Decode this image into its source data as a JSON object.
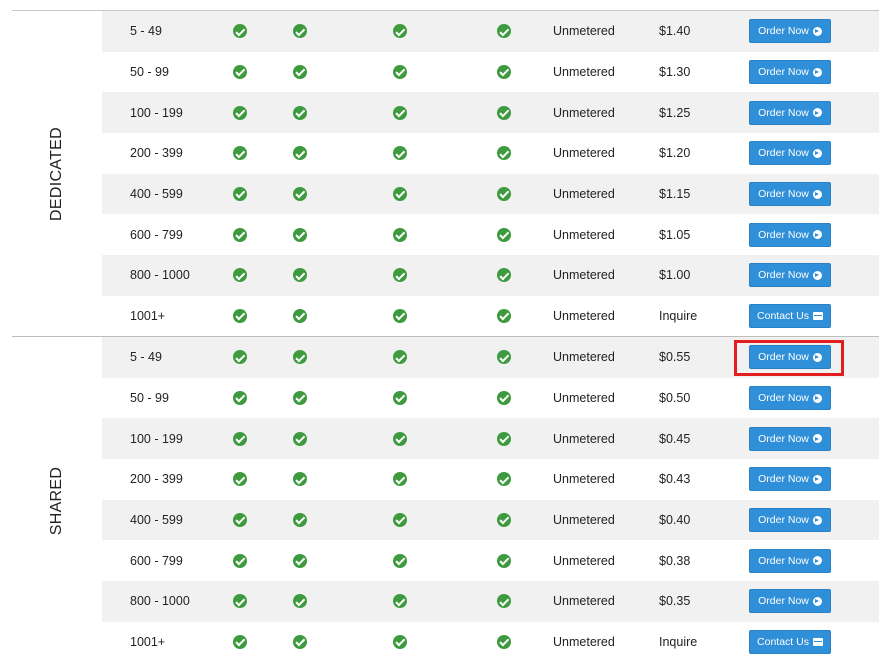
{
  "colors": {
    "accent": "#2f8fd8",
    "check": "#3e9a3e",
    "row_alt": "#f1f1f1",
    "highlight": "#e21e1e"
  },
  "groups": [
    {
      "label": "DEDICATED",
      "rows": [
        {
          "range": "5 - 49",
          "bandwidth": "Unmetered",
          "price": "$1.40",
          "button": "Order Now",
          "icon": "arrow-circle-right-icon"
        },
        {
          "range": "50 - 99",
          "bandwidth": "Unmetered",
          "price": "$1.30",
          "button": "Order Now",
          "icon": "arrow-circle-right-icon"
        },
        {
          "range": "100 - 199",
          "bandwidth": "Unmetered",
          "price": "$1.25",
          "button": "Order Now",
          "icon": "arrow-circle-right-icon"
        },
        {
          "range": "200 - 399",
          "bandwidth": "Unmetered",
          "price": "$1.20",
          "button": "Order Now",
          "icon": "arrow-circle-right-icon"
        },
        {
          "range": "400 - 599",
          "bandwidth": "Unmetered",
          "price": "$1.15",
          "button": "Order Now",
          "icon": "arrow-circle-right-icon"
        },
        {
          "range": "600 - 799",
          "bandwidth": "Unmetered",
          "price": "$1.05",
          "button": "Order Now",
          "icon": "arrow-circle-right-icon"
        },
        {
          "range": "800 - 1000",
          "bandwidth": "Unmetered",
          "price": "$1.00",
          "button": "Order Now",
          "icon": "arrow-circle-right-icon"
        },
        {
          "range": "1001+",
          "bandwidth": "Unmetered",
          "price": "Inquire",
          "button": "Contact Us",
          "icon": "envelope-icon"
        }
      ]
    },
    {
      "label": "SHARED",
      "rows": [
        {
          "range": "5 - 49",
          "bandwidth": "Unmetered",
          "price": "$0.55",
          "button": "Order Now",
          "icon": "arrow-circle-right-icon"
        },
        {
          "range": "50 - 99",
          "bandwidth": "Unmetered",
          "price": "$0.50",
          "button": "Order Now",
          "icon": "arrow-circle-right-icon"
        },
        {
          "range": "100 - 199",
          "bandwidth": "Unmetered",
          "price": "$0.45",
          "button": "Order Now",
          "icon": "arrow-circle-right-icon"
        },
        {
          "range": "200 - 399",
          "bandwidth": "Unmetered",
          "price": "$0.43",
          "button": "Order Now",
          "icon": "arrow-circle-right-icon"
        },
        {
          "range": "400 - 599",
          "bandwidth": "Unmetered",
          "price": "$0.40",
          "button": "Order Now",
          "icon": "arrow-circle-right-icon"
        },
        {
          "range": "600 - 799",
          "bandwidth": "Unmetered",
          "price": "$0.38",
          "button": "Order Now",
          "icon": "arrow-circle-right-icon"
        },
        {
          "range": "800 - 1000",
          "bandwidth": "Unmetered",
          "price": "$0.35",
          "button": "Order Now",
          "icon": "arrow-circle-right-icon"
        },
        {
          "range": "1001+",
          "bandwidth": "Unmetered",
          "price": "Inquire",
          "button": "Contact Us",
          "icon": "envelope-icon"
        }
      ]
    }
  ]
}
